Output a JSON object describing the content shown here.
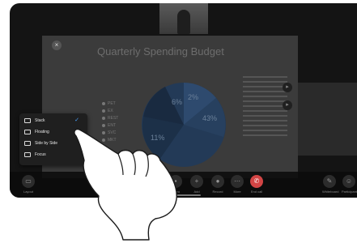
{
  "presentation": {
    "title": "Quarterly Spending Budget",
    "legend": [
      "PET",
      "EX",
      "REST",
      "ENT",
      "SVC",
      "MKT"
    ],
    "pie_labels": [
      "6%",
      "2%",
      "43%",
      "11%"
    ]
  },
  "layout_menu": {
    "items": [
      {
        "label": "Stack",
        "icon": "stack-icon",
        "selected": true
      },
      {
        "label": "Floating",
        "icon": "floating-icon",
        "selected": false
      },
      {
        "label": "Side by Side",
        "icon": "side-by-side-icon",
        "selected": false
      },
      {
        "label": "Focus",
        "icon": "focus-icon",
        "selected": false
      }
    ]
  },
  "controls": {
    "layout": "Layout",
    "mute": "Mute",
    "video": "Video",
    "add": "Add",
    "record": "Record",
    "more": "More",
    "end_call": "End call",
    "whiteboard": "Whiteboard",
    "participants": "Participants"
  },
  "colors": {
    "end_call": "#d24545",
    "check": "#4aa3ff"
  }
}
